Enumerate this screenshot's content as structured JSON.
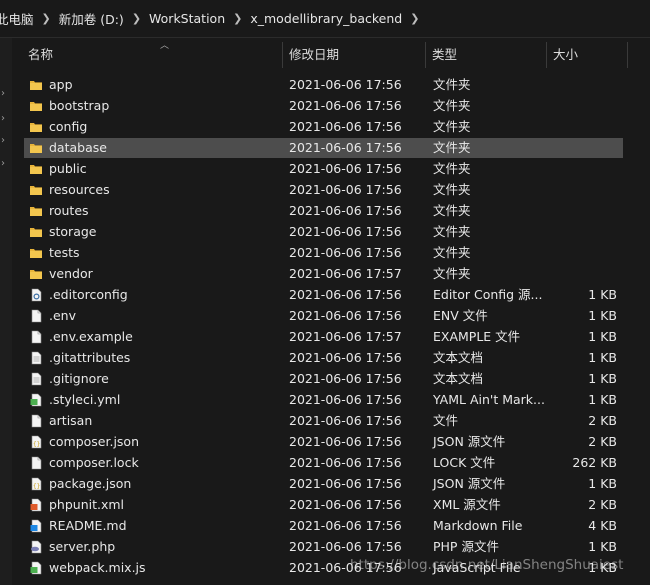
{
  "breadcrumb": [
    "此电脑",
    "新加卷 (D:)",
    "WorkStation",
    "x_modellibrary_backend"
  ],
  "columns": {
    "name": "名称",
    "date": "修改日期",
    "type": "类型",
    "size": "大小"
  },
  "rows": [
    {
      "name": "app",
      "date": "2021-06-06 17:56",
      "type": "文件夹",
      "size": "",
      "icon": "folder-icon"
    },
    {
      "name": "bootstrap",
      "date": "2021-06-06 17:56",
      "type": "文件夹",
      "size": "",
      "icon": "folder-icon"
    },
    {
      "name": "config",
      "date": "2021-06-06 17:56",
      "type": "文件夹",
      "size": "",
      "icon": "folder-icon"
    },
    {
      "name": "database",
      "date": "2021-06-06 17:56",
      "type": "文件夹",
      "size": "",
      "icon": "folder-icon",
      "selected": true
    },
    {
      "name": "public",
      "date": "2021-06-06 17:56",
      "type": "文件夹",
      "size": "",
      "icon": "folder-icon"
    },
    {
      "name": "resources",
      "date": "2021-06-06 17:56",
      "type": "文件夹",
      "size": "",
      "icon": "folder-icon"
    },
    {
      "name": "routes",
      "date": "2021-06-06 17:56",
      "type": "文件夹",
      "size": "",
      "icon": "folder-icon"
    },
    {
      "name": "storage",
      "date": "2021-06-06 17:56",
      "type": "文件夹",
      "size": "",
      "icon": "folder-icon"
    },
    {
      "name": "tests",
      "date": "2021-06-06 17:56",
      "type": "文件夹",
      "size": "",
      "icon": "folder-icon"
    },
    {
      "name": "vendor",
      "date": "2021-06-06 17:57",
      "type": "文件夹",
      "size": "",
      "icon": "folder-icon"
    },
    {
      "name": ".editorconfig",
      "date": "2021-06-06 17:56",
      "type": "Editor Config 源...",
      "size": "1 KB",
      "icon": "gear-file-icon"
    },
    {
      "name": ".env",
      "date": "2021-06-06 17:56",
      "type": "ENV 文件",
      "size": "1 KB",
      "icon": "file-icon"
    },
    {
      "name": ".env.example",
      "date": "2021-06-06 17:57",
      "type": "EXAMPLE 文件",
      "size": "1 KB",
      "icon": "file-icon"
    },
    {
      "name": ".gitattributes",
      "date": "2021-06-06 17:56",
      "type": "文本文档",
      "size": "1 KB",
      "icon": "text-file-icon"
    },
    {
      "name": ".gitignore",
      "date": "2021-06-06 17:56",
      "type": "文本文档",
      "size": "1 KB",
      "icon": "text-file-icon"
    },
    {
      "name": ".styleci.yml",
      "date": "2021-06-06 17:56",
      "type": "YAML Ain't Mark...",
      "size": "1 KB",
      "icon": "yaml-file-icon"
    },
    {
      "name": "artisan",
      "date": "2021-06-06 17:56",
      "type": "文件",
      "size": "2 KB",
      "icon": "file-icon"
    },
    {
      "name": "composer.json",
      "date": "2021-06-06 17:56",
      "type": "JSON 源文件",
      "size": "2 KB",
      "icon": "json-file-icon"
    },
    {
      "name": "composer.lock",
      "date": "2021-06-06 17:56",
      "type": "LOCK 文件",
      "size": "262 KB",
      "icon": "file-icon"
    },
    {
      "name": "package.json",
      "date": "2021-06-06 17:56",
      "type": "JSON 源文件",
      "size": "1 KB",
      "icon": "json-file-icon"
    },
    {
      "name": "phpunit.xml",
      "date": "2021-06-06 17:56",
      "type": "XML 源文件",
      "size": "2 KB",
      "icon": "xml-file-icon"
    },
    {
      "name": "README.md",
      "date": "2021-06-06 17:56",
      "type": "Markdown File",
      "size": "4 KB",
      "icon": "markdown-file-icon"
    },
    {
      "name": "server.php",
      "date": "2021-06-06 17:56",
      "type": "PHP 源文件",
      "size": "1 KB",
      "icon": "php-file-icon"
    },
    {
      "name": "webpack.mix.js",
      "date": "2021-06-06 17:56",
      "type": "JavaScript File",
      "size": "1 KB",
      "icon": "js-file-icon"
    }
  ],
  "watermark": "https://blog.csdn.net/LianShengShuaiest",
  "colors": {
    "folder": "#f3c64e",
    "selected_row": "#4d4d4d",
    "background": "#191919"
  }
}
